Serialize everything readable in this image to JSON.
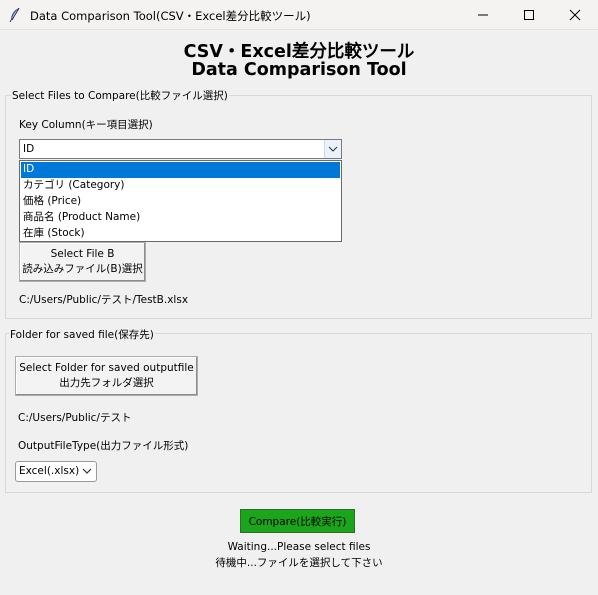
{
  "window": {
    "title": "Data Comparison Tool(CSV・Excel差分比較ツール)"
  },
  "header": {
    "title_jp": "CSV・Excel差分比較ツール",
    "title_en": "Data Comparison Tool"
  },
  "file_group": {
    "label": "Select Files to Compare(比較ファイル選択)",
    "key_column_label": "Key Column(キー項目選択)",
    "key_column_value": "ID",
    "key_column_options": [
      "ID",
      "カテゴリ (Category)",
      "価格 (Price)",
      "商品名 (Product Name)",
      "在庫 (Stock)"
    ],
    "selected_option_index": 0,
    "file_b_button_line1": "Select File B",
    "file_b_button_line2": "読み込みファイル(B)選択",
    "file_b_path": "C:/Users/Public/テスト/TestB.xlsx"
  },
  "output_group": {
    "label": "Folder for saved file(保存先)",
    "folder_button_line1": "Select Folder for saved outputfile",
    "folder_button_line2": "出力先フォルダ選択",
    "folder_path": "C:/Users/Public/テスト",
    "file_type_label": "OutputFileType(出力ファイル形式)",
    "file_type_value": "Excel(.xlsx)"
  },
  "actions": {
    "compare_label": "Compare(比較実行)",
    "accent_color": "#1aa51a"
  },
  "status": {
    "line1": "Waiting...Please select files",
    "line2": "待機中...ファイルを選択して下さい"
  },
  "icons": {
    "app": "feather-icon",
    "minimize": "minimize-icon",
    "maximize": "maximize-icon",
    "close": "close-icon",
    "combo_arrow": "chevron-down-icon",
    "select_arrow": "chevron-down-icon"
  }
}
